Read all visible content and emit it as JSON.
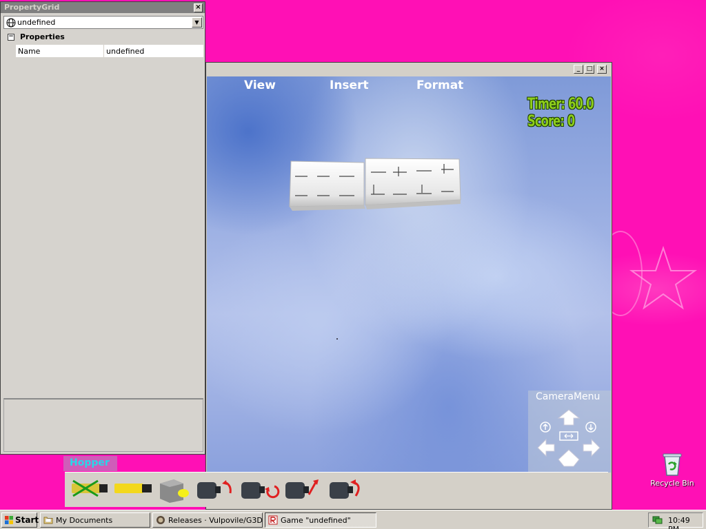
{
  "property_grid": {
    "title": "PropertyGrid",
    "close_glyph": "×",
    "object_combo": {
      "value": "undefined",
      "icon": "globe-icon",
      "dropdown_glyph": "▼"
    },
    "category": {
      "toggle_glyph": "−",
      "label": "Properties"
    },
    "rows": [
      {
        "name": "Name",
        "value": "undefined"
      }
    ]
  },
  "game_window": {
    "window_buttons": {
      "minimize": "_",
      "maximize": "□",
      "close": "×"
    },
    "menu": [
      {
        "label": "View"
      },
      {
        "label": "Insert"
      },
      {
        "label": "Format"
      }
    ],
    "hud": {
      "timer": "Timer: 60.0",
      "score": "Score: 0"
    },
    "camera_menu": {
      "title": "CameraMenu",
      "buttons": [
        "zoom-in-icon",
        "tilt-up-icon",
        "zoom-out-icon",
        "pan-left-icon",
        "center-icon",
        "pan-right-icon",
        "tilt-down-icon"
      ]
    },
    "toolbar_label": "Hopper",
    "tools": [
      "hopper-bin-disabled-icon",
      "hopper-bin-icon",
      "cube-tool-icon",
      "motor-ccw-icon",
      "motor-cw-icon",
      "motor-up-icon",
      "motor-right-icon"
    ]
  },
  "desktop": {
    "recycle_bin_label": "Recycle Bin",
    "recycle_bin_icon": "recycle-bin-icon"
  },
  "taskbar": {
    "start_label": "Start",
    "tasks": [
      {
        "label": "My Documents",
        "icon": "folder-icon",
        "active": false
      },
      {
        "label": "Releases · Vulpovile/G3D...",
        "icon": "browser-icon",
        "active": false
      },
      {
        "label": "Game \"undefined\"",
        "icon": "roblox-icon",
        "active": true
      }
    ],
    "clock": "10:49 PM",
    "tray_icon": "network-icon"
  },
  "colors": {
    "desktop_pink": "#ff10b5",
    "hud_green": "#8dcd1c",
    "toolbar_label_cyan": "#28d8e8",
    "window_face": "#d4d0c8"
  }
}
